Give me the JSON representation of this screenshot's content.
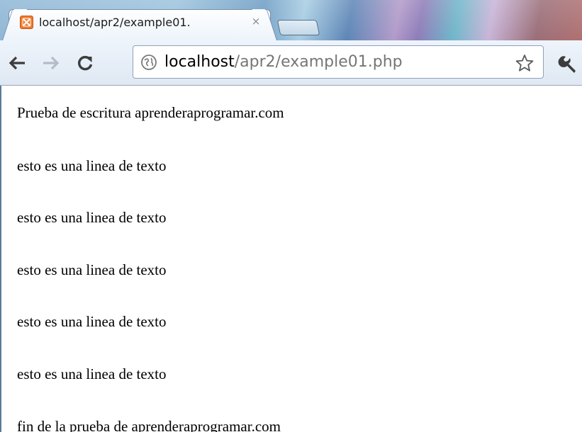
{
  "browser": {
    "tab": {
      "title": "localhost/apr2/example01.",
      "close_glyph": "×",
      "favicon": "xampp-icon"
    },
    "toolbar": {
      "back_icon": "back-arrow-icon",
      "forward_icon": "forward-arrow-icon",
      "reload_icon": "reload-icon",
      "url_host": "localhost",
      "url_path": "/apr2/example01.php",
      "page_icon": "globe-icon",
      "bookmark_icon": "star-icon",
      "menu_icon": "wrench-icon"
    }
  },
  "page": {
    "lines": [
      "Prueba de escritura aprenderaprogramar.com",
      "esto es una linea de texto",
      "esto es una linea de texto",
      "esto es una linea de texto",
      "esto es una linea de texto",
      "esto es una linea de texto",
      "fin de la prueba de aprenderaprogramar.com"
    ]
  },
  "colors": {
    "favicon_orange": "#f07a2b",
    "url_host": "#000000",
    "url_path": "#767676",
    "page_background": "#ffffff"
  }
}
